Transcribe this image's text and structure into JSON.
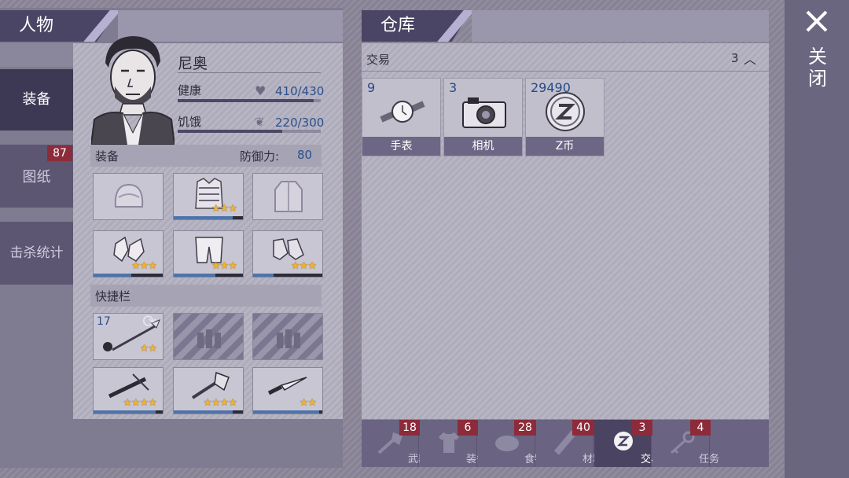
{
  "left_panel": {
    "title": "人物",
    "tabs": [
      {
        "label": "装备",
        "active": true,
        "badge": ""
      },
      {
        "label": "图纸",
        "active": false,
        "badge": "87"
      },
      {
        "label": "击杀统计",
        "active": false,
        "badge": ""
      }
    ],
    "character": {
      "name": "尼奥",
      "health_label": "健康",
      "health_value": "410/430",
      "health_fraction": 0.953,
      "hunger_label": "饥饿",
      "hunger_value": "220/300",
      "hunger_fraction": 0.733
    },
    "equipment": {
      "section_label": "装备",
      "defense_label": "防御力:",
      "defense_value": "80",
      "slots": [
        {
          "icon": "helmet-icon",
          "stars": "",
          "durability": 0
        },
        {
          "icon": "body-armor-icon",
          "stars": "★★★",
          "durability": 0.85
        },
        {
          "icon": "jacket-icon",
          "stars": "",
          "durability": 0
        },
        {
          "icon": "gloves-icon",
          "stars": "★★★",
          "durability": 0.55
        },
        {
          "icon": "pants-icon",
          "stars": "★★★",
          "durability": 0.6
        },
        {
          "icon": "boots-icon",
          "stars": "★★★",
          "durability": 0.3
        }
      ]
    },
    "quickbar": {
      "section_label": "快捷栏",
      "slots": [
        {
          "icon": "spear-icon",
          "count": "17",
          "stars": "★★",
          "locked": false,
          "durability": 0
        },
        {
          "icon": "locked-slot-icon",
          "count": "",
          "stars": "",
          "locked": true,
          "durability": 0
        },
        {
          "icon": "locked-slot-icon",
          "count": "",
          "stars": "",
          "locked": true,
          "durability": 0
        },
        {
          "icon": "crossbow-icon",
          "count": "",
          "stars": "★★★★",
          "locked": false,
          "durability": 0.9
        },
        {
          "icon": "axe-icon",
          "count": "",
          "stars": "★★★★",
          "locked": false,
          "durability": 0.85
        },
        {
          "icon": "knife-icon",
          "count": "",
          "stars": "★★",
          "locked": false,
          "durability": 0.95
        }
      ]
    }
  },
  "warehouse": {
    "title": "仓库",
    "category_label": "交易",
    "category_count": "3",
    "items": [
      {
        "count": "9",
        "label": "手表",
        "icon": "watch-icon"
      },
      {
        "count": "3",
        "label": "相机",
        "icon": "camera-icon"
      },
      {
        "count": "29490",
        "label": "Z币",
        "icon": "z-coin-icon"
      }
    ],
    "bottom_tabs": [
      {
        "label": "武器",
        "badge": "18",
        "icon": "axe-icon",
        "active": false
      },
      {
        "label": "装备",
        "badge": "6",
        "icon": "shirt-icon",
        "active": false
      },
      {
        "label": "食物",
        "badge": "28",
        "icon": "food-icon",
        "active": false
      },
      {
        "label": "材料",
        "badge": "40",
        "icon": "material-icon",
        "active": false
      },
      {
        "label": "交易",
        "badge": "3",
        "icon": "z-coin-icon",
        "active": true
      },
      {
        "label": "任务",
        "badge": "4",
        "icon": "key-icon",
        "active": false
      }
    ]
  },
  "close": {
    "label": "关闭",
    "icon": "close-icon"
  },
  "colors": {
    "accent": "#4b4565",
    "badge": "#8c2c3a",
    "value_blue": "#2c4f8a",
    "star": "#f3b32a"
  }
}
